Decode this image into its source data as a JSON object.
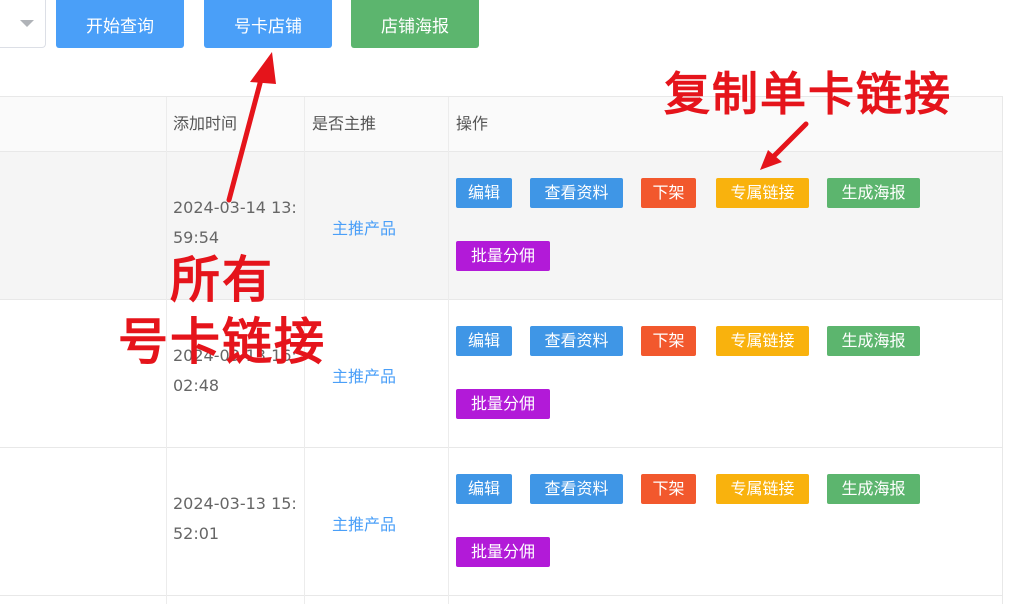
{
  "toolbar": {
    "query_label": "开始查询",
    "card_shop_label": "号卡店铺",
    "shop_poster_label": "店铺海报"
  },
  "table": {
    "headers": {
      "added_time": "添加时间",
      "is_promoted": "是否主推",
      "operations": "操作"
    },
    "rows": [
      {
        "time": "2024-03-14 13:59:54",
        "promoted": "主推产品"
      },
      {
        "time": "2024-03-13 16:02:48",
        "promoted": "主推产品"
      },
      {
        "time": "2024-03-13 15:52:01",
        "promoted": "主推产品"
      }
    ],
    "actions": {
      "edit": "编辑",
      "view": "查看资料",
      "off_shelf": "下架",
      "exclusive_link": "专属链接",
      "make_poster": "生成海报",
      "bulk_commission": "批量分佣"
    }
  },
  "annotations": {
    "copy_single_link": "复制单卡链接",
    "all_line1": "所有",
    "all_line2": "号卡链接"
  },
  "colors": {
    "primary_blue": "#4a9ff8",
    "danger_red": "#f2582d",
    "warning_orange": "#f9b20d",
    "success_green": "#5cb56e",
    "purple": "#b21ad8",
    "annotation_red": "#e5141b"
  }
}
